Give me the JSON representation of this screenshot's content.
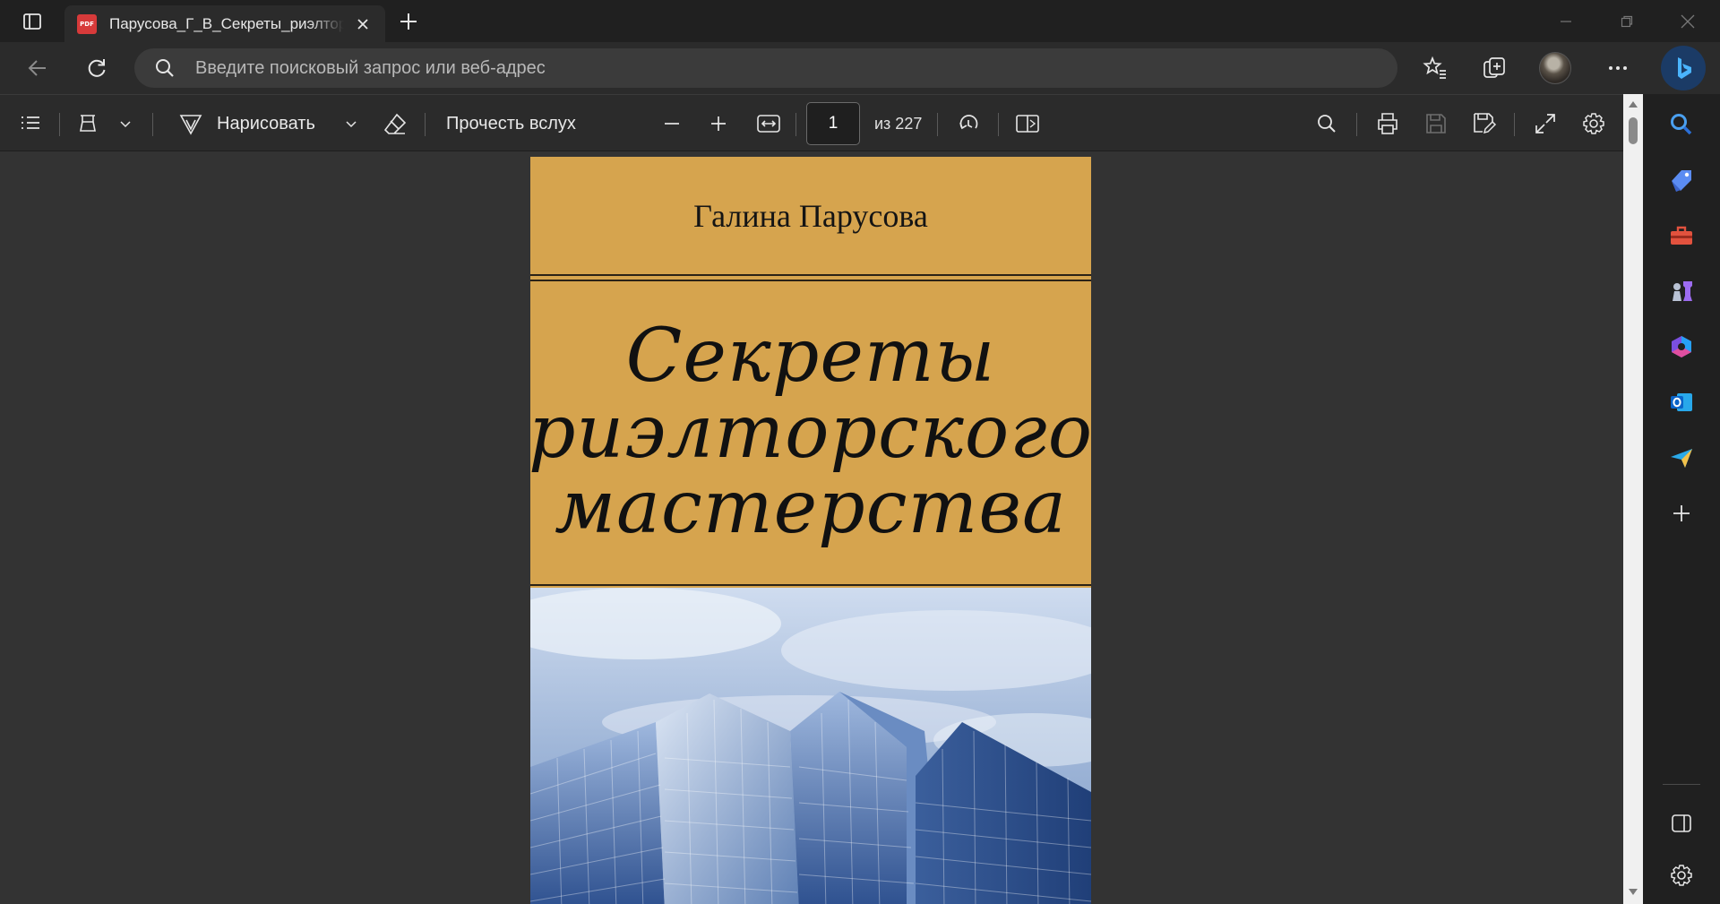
{
  "browser": {
    "tab": {
      "title": "Парусова_Г_В_Секреты_риэлторского_мастерства.pdf",
      "favicon_text": "PDF"
    },
    "address_bar": {
      "placeholder": "Введите поисковый запрос или веб-адрес",
      "value": ""
    },
    "window_controls": [
      "minimize",
      "restore",
      "close"
    ],
    "toolbar_icons": [
      "favorites-icon",
      "collections-icon",
      "profile-avatar",
      "more-icon",
      "bing-copilot-icon"
    ]
  },
  "pdf_toolbar": {
    "draw_label": "Нарисовать",
    "read_aloud_label": "Прочесть вслух",
    "current_page": "1",
    "page_total": "из 227"
  },
  "document": {
    "author": "Галина Парусова",
    "title_lines": [
      "Секреты",
      "риэлторского",
      "мастерства"
    ]
  },
  "sidebar": {
    "items": [
      "search",
      "shopping",
      "tools",
      "games",
      "microsoft-365",
      "outlook",
      "drop",
      "add"
    ],
    "bottom": [
      "split-screen",
      "settings"
    ]
  },
  "colors": {
    "cover_background": "#d6a44e",
    "viewer_background": "#333333",
    "chrome_dark": "#202020"
  }
}
